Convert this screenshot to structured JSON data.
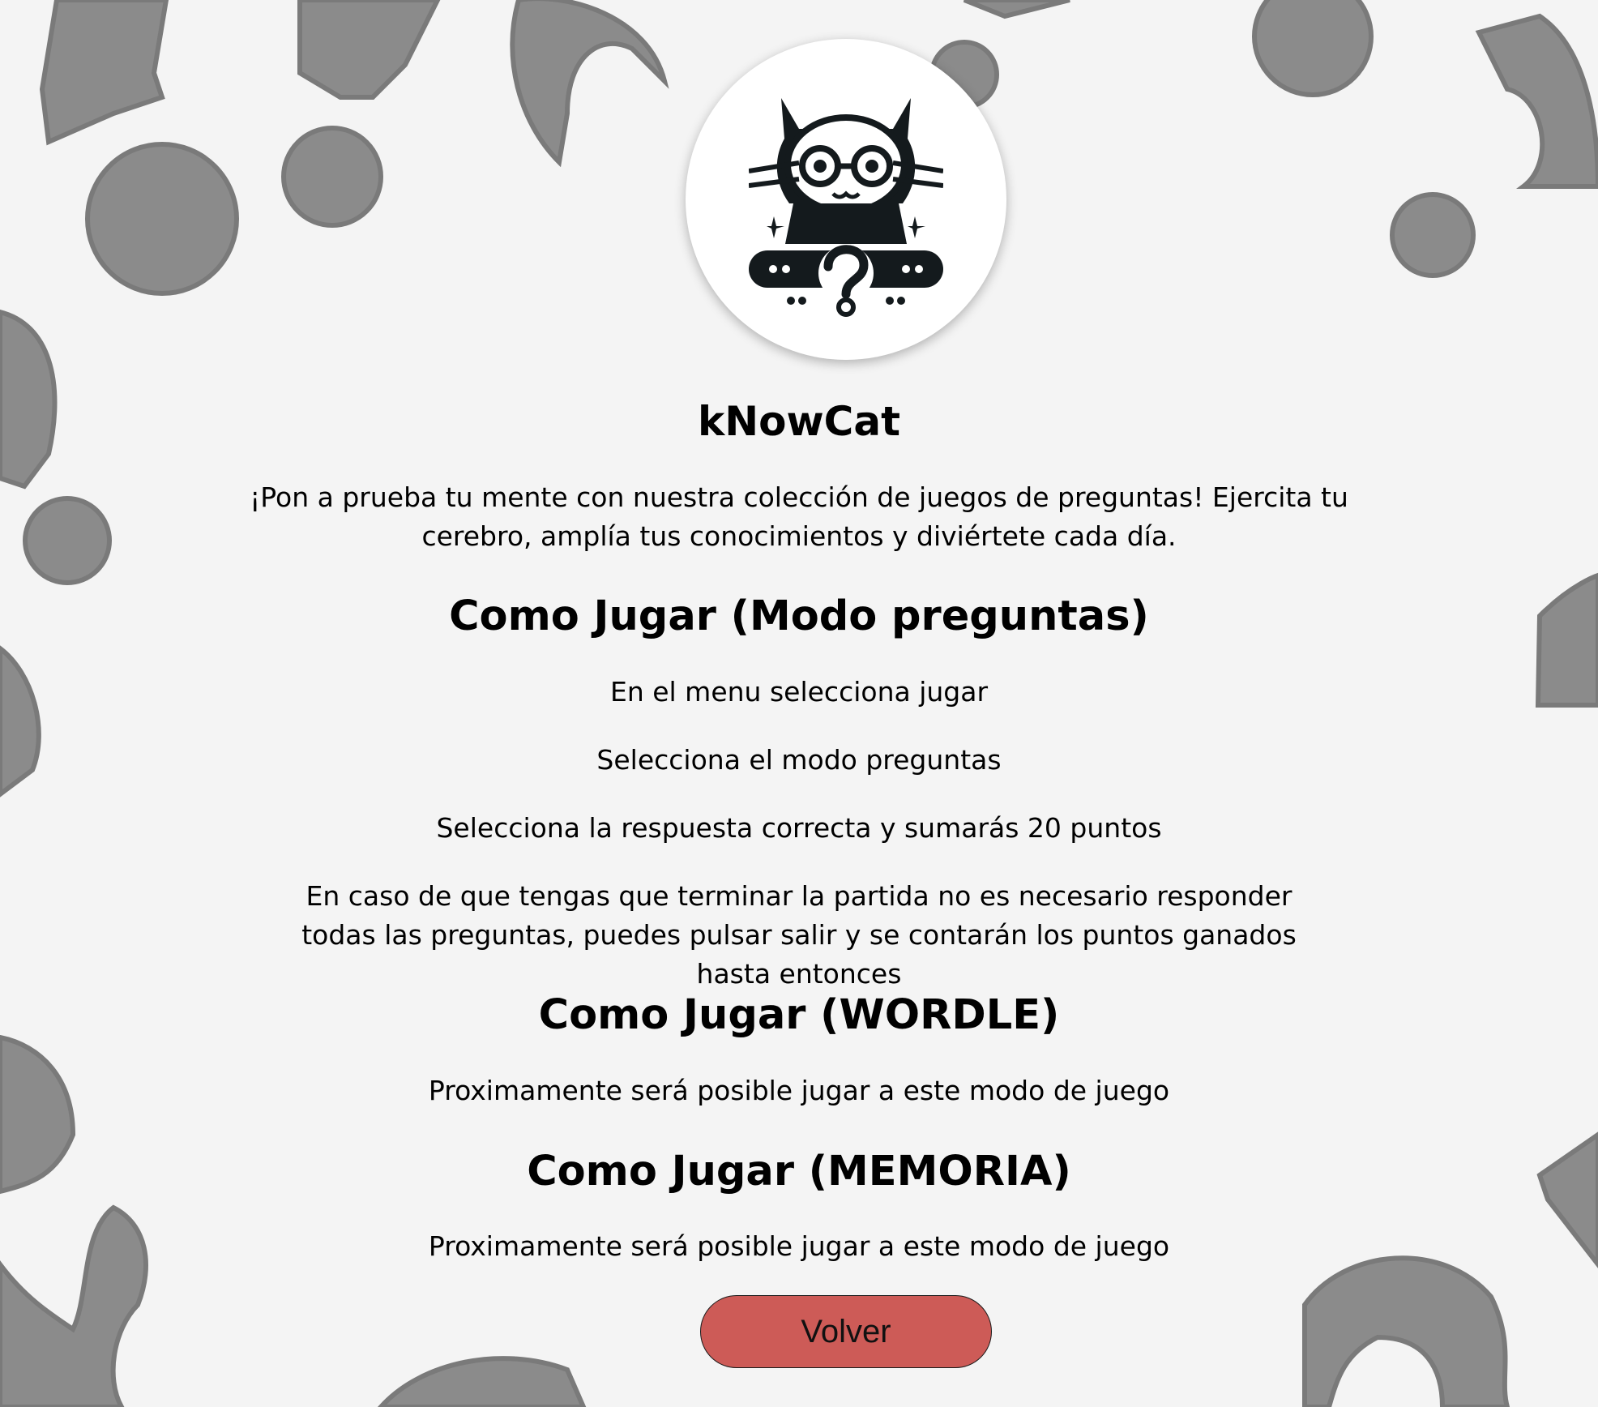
{
  "app": {
    "title": "kNowCat",
    "logo": "knowcat-logo-cat-with-glasses-question-mark",
    "intro": "¡Pon a prueba tu mente con nuestra colección de juegos de preguntas! Ejercita tu cerebro, amplía tus conocimientos y diviértete cada día."
  },
  "sections": [
    {
      "title": "Como Jugar (Modo preguntas)",
      "steps": [
        "En el menu selecciona jugar",
        "Selecciona el modo preguntas",
        "Selecciona la respuesta correcta y sumarás 20 puntos",
        "En caso de que tengas que terminar la partida no es necesario responder todas las preguntas, puedes pulsar salir y se contarán los puntos ganados hasta entonces"
      ]
    },
    {
      "title": "Como Jugar (WORDLE)",
      "steps": [
        "Proximamente será posible jugar a este modo de juego"
      ]
    },
    {
      "title": "Como Jugar (MEMORIA)",
      "steps": [
        "Proximamente será posible jugar a este modo de juego"
      ]
    }
  ],
  "back_button": {
    "label": "Volver"
  },
  "colors": {
    "background": "#f4f4f4",
    "decor": "#8b8b8b",
    "button": "#cd5b57"
  }
}
